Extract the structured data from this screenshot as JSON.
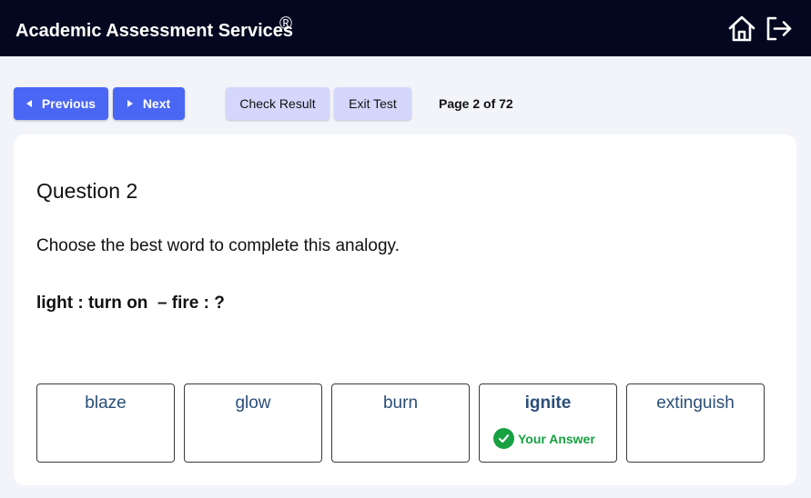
{
  "header": {
    "brand": "Academic Assessment Services",
    "registered_mark": "®",
    "home_icon": "home-icon",
    "logout_icon": "logout-icon"
  },
  "toolbar": {
    "previous_label": "Previous",
    "next_label": "Next",
    "check_result_label": "Check Result",
    "exit_test_label": "Exit Test",
    "page_indicator": "Page 2 of 72"
  },
  "question": {
    "title": "Question 2",
    "prompt": "Choose the best word to complete this analogy.",
    "analogy": "light : turn on  – fire : ?",
    "options": [
      {
        "label": "blaze"
      },
      {
        "label": "glow"
      },
      {
        "label": "burn"
      },
      {
        "label": "ignite"
      },
      {
        "label": "extinguish"
      }
    ],
    "selected_index": 3,
    "your_answer_label": "Your Answer"
  },
  "colors": {
    "header_bg": "#03071f",
    "nav_button": "#4a66f5",
    "secondary_button": "#d4d7fb",
    "option_text": "#2a4e78",
    "answer_green": "#17a142"
  }
}
